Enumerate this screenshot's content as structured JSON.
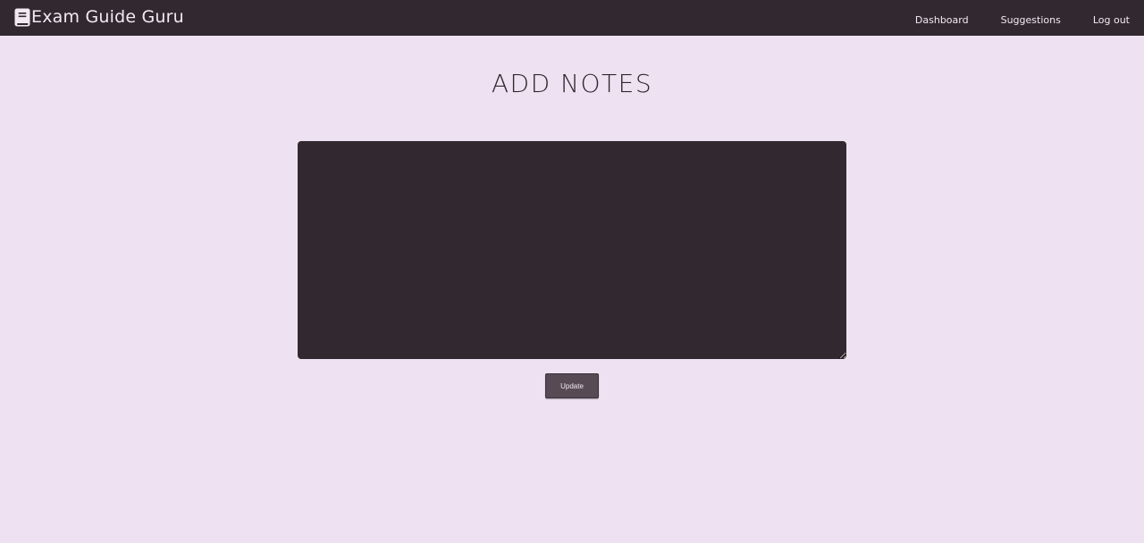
{
  "navbar": {
    "brand_icon": "book-icon",
    "brand_title": "Exam Guide Guru",
    "links": [
      {
        "label": "Dashboard"
      },
      {
        "label": "Suggestions"
      },
      {
        "label": "Log out"
      }
    ]
  },
  "main": {
    "title": "ADD NOTES",
    "notes_value": "",
    "update_label": "Update"
  },
  "colors": {
    "navbar_bg": "#32282f",
    "page_bg": "#eee2f2",
    "textarea_bg": "#32282f",
    "button_bg": "#574a55",
    "text_light": "#f2eaf3"
  }
}
